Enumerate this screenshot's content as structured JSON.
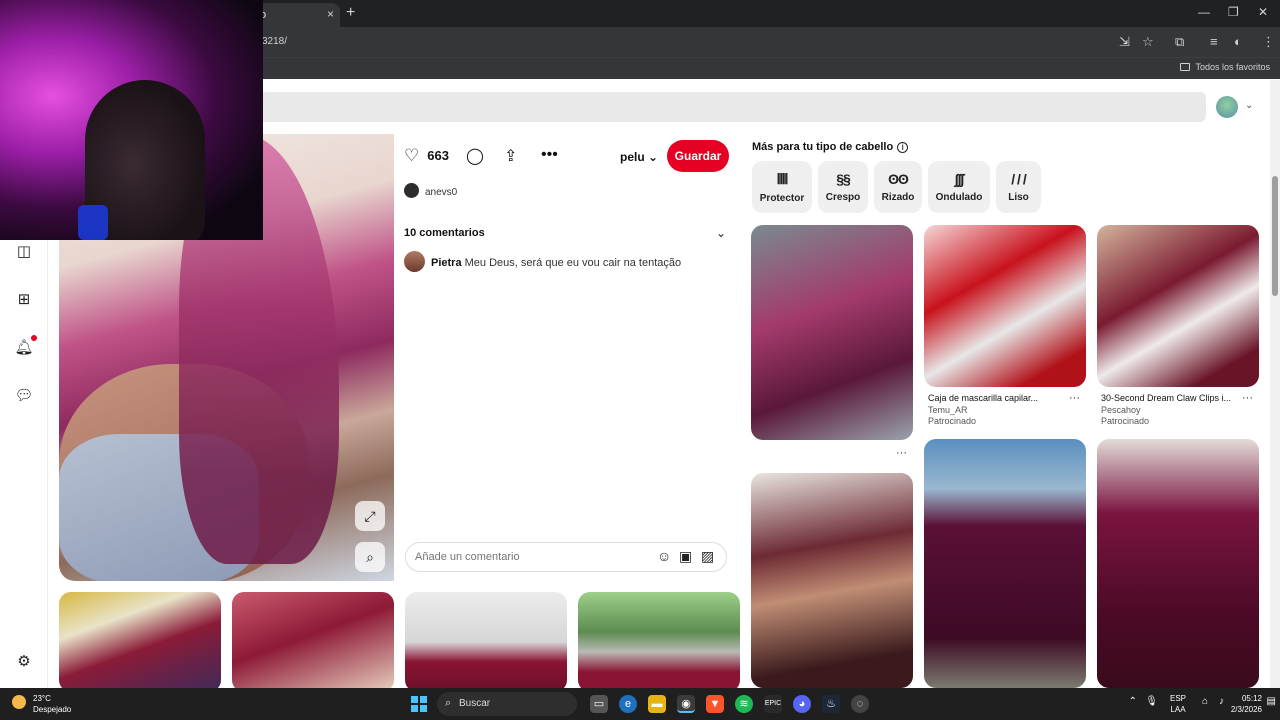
{
  "browser": {
    "tab_title": "o",
    "tab_close": "×",
    "new_tab": "+",
    "url": "3218/",
    "bookmark_folder": "Todos los favoritos",
    "window_controls": [
      "—",
      "❐",
      "✕"
    ]
  },
  "pin": {
    "likes": "663",
    "board_select": "pelu",
    "save_label": "Guardar",
    "author": "anevs0",
    "comments_header": "10 comentarios",
    "comment_author": "Pietra",
    "comment_text": "Meu Deus, será que eu vou cair na tentação",
    "comment_placeholder": "Añade un comentario"
  },
  "more_section": {
    "title": "Más para tu tipo de cabello",
    "chips": [
      {
        "label": "Protector",
        "icon": "protector-hair-icon"
      },
      {
        "label": "Crespo",
        "icon": "curly-hair-icon"
      },
      {
        "label": "Rizado",
        "icon": "wavy-curl-hair-icon"
      },
      {
        "label": "Ondulado",
        "icon": "wavy-hair-icon"
      },
      {
        "label": "Liso",
        "icon": "straight-hair-icon"
      }
    ]
  },
  "tiles": [
    {
      "title": "Caja de mascarilla capilar...",
      "source": "Temu_AR",
      "tag": "Patrocinado"
    },
    {
      "title": "30-Second Dream Claw Clips i...",
      "source": "Pescahoy",
      "tag": "Patrocinado"
    }
  ],
  "taskbar": {
    "temperature": "23°C",
    "condition": "Despejado",
    "search_label": "Buscar",
    "lang_top": "ESP",
    "lang_bottom": "LAA",
    "time": "05:12",
    "date": "2/3/2026"
  },
  "colors": {
    "brand_red": "#e60023",
    "chrome_dark": "#202124",
    "taskbar": "#1f1f1f"
  }
}
